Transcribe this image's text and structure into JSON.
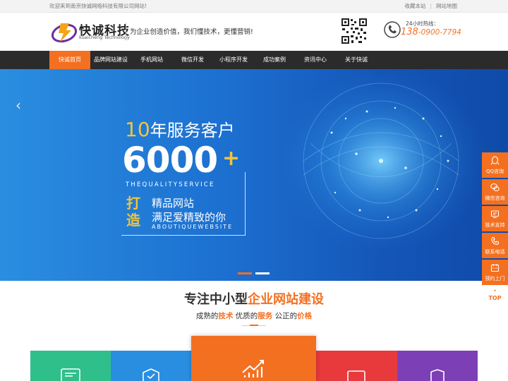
{
  "topbar": {
    "welcome": "欢迎来到南京快诚网络科技有限公司网站!",
    "links": [
      "收藏本站",
      "网站地图"
    ],
    "separator": "|"
  },
  "header": {
    "logo_cn": "快诚科技",
    "logo_en": "kuaicheng Technology",
    "slogan": "为企业创造价值，我们懂技术，更懂营销!",
    "hotline_label": "24小时热线：",
    "hotline_prefix": "138",
    "hotline_rest": "-0900-7794"
  },
  "nav": {
    "items": [
      {
        "label": "快诚首页",
        "active": true
      },
      {
        "label": "品牌网站建设"
      },
      {
        "label": "手机网站"
      },
      {
        "label": "微信开发"
      },
      {
        "label": "小程序开发"
      },
      {
        "label": "成功案例"
      },
      {
        "label": "资讯中心"
      },
      {
        "label": "关于快诚"
      }
    ]
  },
  "banner": {
    "years_num": "10",
    "years_text": "年服务客户",
    "big_number": "6000",
    "plus": "+",
    "en_line1": "THEQUALITYSERVICE",
    "vertical_text": "打造",
    "line_jp": "精品网站",
    "line_mz": "满足爱精致的你",
    "en_line2": "ABOUTIQUEWEBSITE",
    "prev_arrow": "‹",
    "slides_total": 2,
    "active_slide": 1
  },
  "side_tools": {
    "items": [
      {
        "label": "QQ咨询",
        "icon": "qq-icon"
      },
      {
        "label": "微信咨询",
        "icon": "wechat-icon"
      },
      {
        "label": "技术支持",
        "icon": "support-icon"
      },
      {
        "label": "联系电话",
        "icon": "phone-icon"
      },
      {
        "label": "预约上门",
        "icon": "calendar-icon"
      }
    ],
    "top_label": "TOP",
    "top_arrow": "•"
  },
  "section": {
    "title_a": "专注中小型",
    "title_hl": "企业网站建设",
    "sub_a": "成熟的",
    "sub_h1": "技术",
    "sub_b": " 优质的",
    "sub_h2": "服务",
    "sub_c": " 公正的",
    "sub_h3": "价格"
  },
  "colors": {
    "accent": "#f37021",
    "nav_bg": "#2b2b2b",
    "banner_blue": "#1c6fd0",
    "card_green": "#2fbf8a",
    "card_blue": "#2a8ee0",
    "card_orange": "#f37021",
    "card_red": "#e8393d",
    "card_purple": "#7d3fb5"
  },
  "cards": [
    {
      "icon": "monitor-icon",
      "color": "#2fbf8a"
    },
    {
      "icon": "shield-icon",
      "color": "#2a8ee0"
    },
    {
      "icon": "growth-chart-icon",
      "color": "#f37021"
    },
    {
      "icon": "screen-icon",
      "color": "#e8393d"
    },
    {
      "icon": "badge-icon",
      "color": "#7d3fb5"
    }
  ]
}
